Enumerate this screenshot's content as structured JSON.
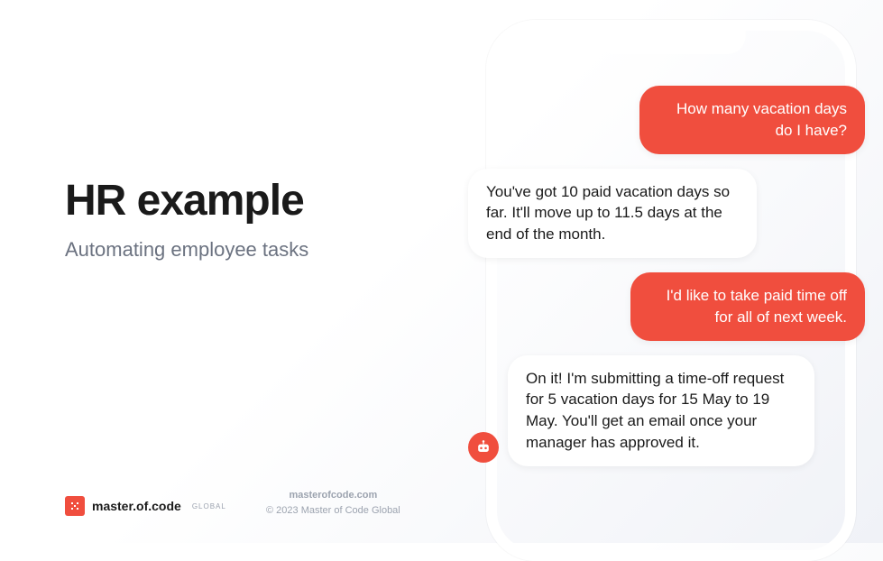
{
  "heading": {
    "title": "HR example",
    "subtitle": "Automating employee tasks"
  },
  "footer": {
    "brand": "master.of.code",
    "brand_sub": "GLOBAL",
    "site": "masterofcode.com",
    "copyright": "© 2023 Master of Code Global"
  },
  "chat": {
    "msg1": "How many vacation days do I have?",
    "msg2": "You've got 10 paid vacation days so far. It'll move up to 11.5 days at the end of the month.",
    "msg3": "I'd like to take paid time off for all of next week.",
    "msg4": "On it! I'm submitting a time-off request for 5 vacation days for 15 May to 19 May. You'll get an email once your manager has approved it."
  }
}
